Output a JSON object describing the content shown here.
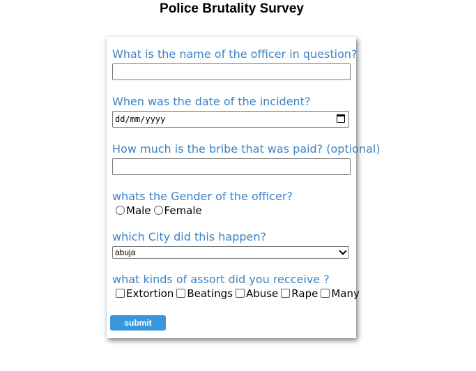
{
  "page": {
    "title": "Police Brutality Survey"
  },
  "form": {
    "officer_name": {
      "label": "What is the name of the officer in question?",
      "value": ""
    },
    "incident_date": {
      "label": "When was the date of the incident?",
      "placeholder": "dd/mm/yyyy"
    },
    "bribe": {
      "label": "How much is the bribe that was paid? (optional)",
      "value": ""
    },
    "gender": {
      "label": "whats the Gender of the officer?",
      "options": [
        "Male",
        "Female"
      ]
    },
    "city": {
      "label": "which City did this happen?",
      "selected": "abuja"
    },
    "assault": {
      "label": "what kinds of assort did you recceive ?",
      "options": [
        "Extortion",
        "Beatings",
        "Abuse",
        "Rape",
        "Many"
      ]
    },
    "submit_label": "submit"
  },
  "colors": {
    "question_text": "#3b82c4",
    "submit_bg": "#3b97dd"
  },
  "icons": {
    "date_picker": "calendar-icon",
    "select": "chevron-down-icon"
  }
}
